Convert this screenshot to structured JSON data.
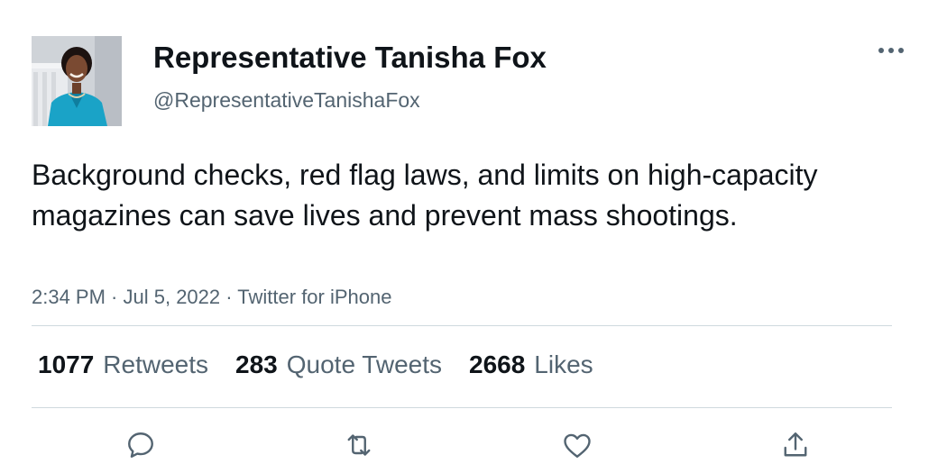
{
  "tweet": {
    "author": {
      "display_name": "Representative Tanisha Fox",
      "handle": "@RepresentativeTanishaFox"
    },
    "text": "Background checks, red flag laws, and limits on high-capacity magazines can save lives and prevent mass shootings.",
    "meta": {
      "time": "2:34 PM",
      "separator": " · ",
      "date": "Jul 5, 2022",
      "source": "Twitter for iPhone"
    },
    "stats": {
      "retweets": {
        "count": "1077",
        "label": "Retweets"
      },
      "quotes": {
        "count": "283",
        "label": "Quote Tweets"
      },
      "likes": {
        "count": "2668",
        "label": "Likes"
      }
    }
  },
  "icons": {
    "more": "more-horizontal-icon",
    "reply": "reply-icon",
    "retweet": "retweet-icon",
    "like": "heart-icon",
    "share": "share-icon"
  },
  "colors": {
    "text_primary": "#0f1419",
    "text_secondary": "#536471",
    "divider": "#cfd9de",
    "avatar_jacket": "#1aa3c7"
  }
}
